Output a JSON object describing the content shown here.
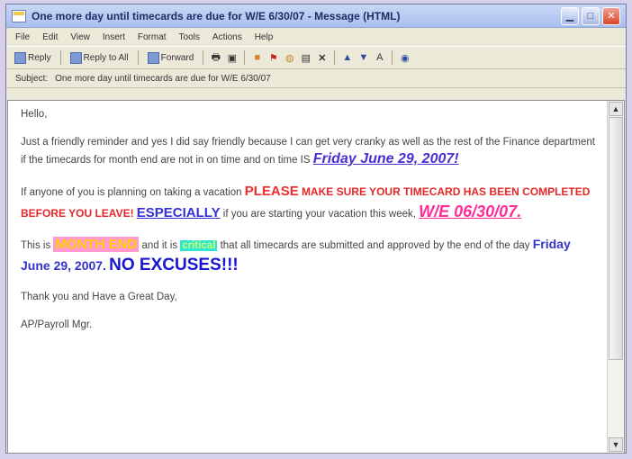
{
  "window": {
    "title": "One more day until timecards are due for W/E 6/30/07 - Message (HTML)"
  },
  "menu": [
    "File",
    "Edit",
    "View",
    "Insert",
    "Format",
    "Tools",
    "Actions",
    "Help"
  ],
  "toolbar": {
    "reply": "Reply",
    "reply_all": "Reply to All",
    "forward": "Forward"
  },
  "subject": {
    "label": "Subject:",
    "value": "One more day until timecards are due for W/E 6/30/07"
  },
  "body": {
    "greeting": "Hello,",
    "p1_text": "Just a friendly reminder and yes I did say friendly because I can get very cranky as well as the rest of the Finance department if the timecards for month end are not in on time and on time IS",
    "p1_date": "Friday June 29, 2007!",
    "p2_text1": "If anyone of you is planning on taking a vacation",
    "p2_please": "PLEASE",
    "p2_make": "MAKE SURE YOUR TIMECARD HAS BEEN COMPLETED BEFORE YOU LEAVE!",
    "p2_especially": "ESPECIALLY",
    "p2_text2": "if you are starting your vacation this week,",
    "p2_we": "W/E 06/30/07.",
    "p3_text1": "This is",
    "p3_month_end": "MONTH END",
    "p3_text2": "and it is",
    "p3_critical": "critical",
    "p3_text3": "that all timecards are submitted and approved by the end of the day",
    "p3_date": "Friday June 29, 2007.",
    "p3_no_excuses": "NO EXCUSES!!!",
    "thanks": "Thank you and Have a Great Day,",
    "signature": "AP/Payroll Mgr."
  }
}
